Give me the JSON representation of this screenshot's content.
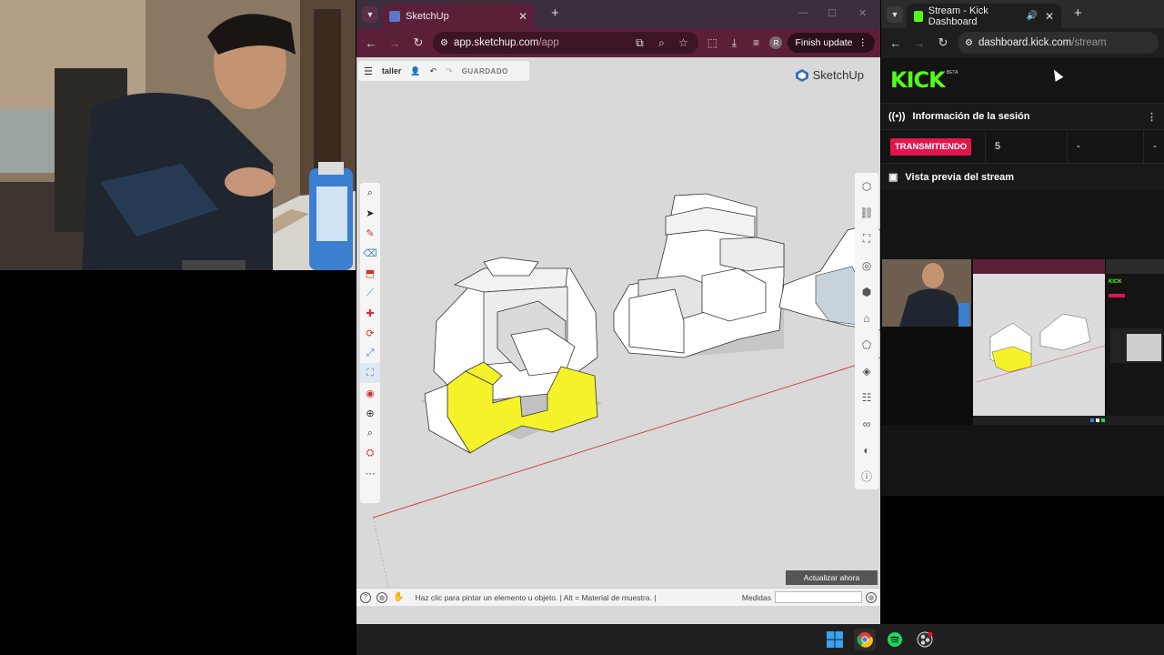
{
  "sketchup": {
    "tab_title": "SketchUp",
    "url_host": "app.sketchup.com",
    "url_path": "/app",
    "finish_update": "Finish update",
    "avatar_letter": "R",
    "project_name": "taller",
    "saved_label": "GUARDADO",
    "logo_text": "SketchUp",
    "update_button": "Actualizar ahora",
    "status_text": "Haz clic para pintar un elemento u objeto. | Alt = Material de muestra. |",
    "measure_label": "Medidas"
  },
  "kick": {
    "tab_title": "Stream - Kick Dashboard",
    "url_host": "dashboard.kick.com",
    "url_path": "/stream",
    "logo_text": "KICK",
    "beta_label": "BETA",
    "session_title": "Información de la sesión",
    "live_badge": "TRANSMITIENDO",
    "viewers": "5",
    "stat2": "-",
    "stat3": "-",
    "preview_title": "Vista previa del stream"
  },
  "colors": {
    "sketchup_frame": "#5b1f3a",
    "kick_green": "#53fc18",
    "live_red": "#e0164c",
    "highlight_yellow": "#f5f229"
  }
}
